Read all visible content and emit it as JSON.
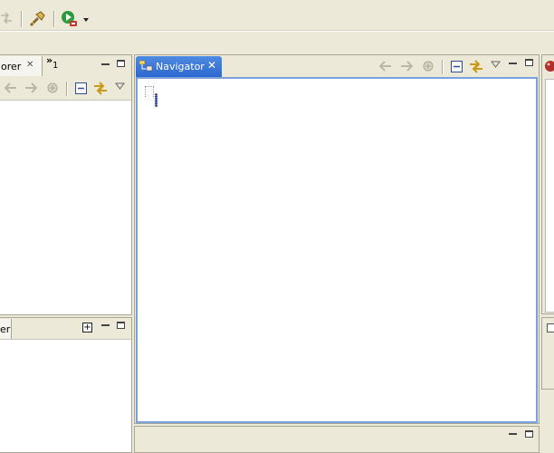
{
  "toolbar": {
    "icons": [
      "nav-arrows-icon",
      "hammer-icon",
      "run-icon",
      "dropdown-arrow-icon"
    ]
  },
  "left_top_view": {
    "tab_label": "orer",
    "close_glyph": "✕",
    "overflow_count": "1",
    "overflow_glyph": "»"
  },
  "left_bottom_view": {
    "tab_label": "er",
    "add_glyph": "+"
  },
  "navigator_view": {
    "tab_label": "Navigator",
    "close_glyph": "✕",
    "accent_color": "#3169c6"
  },
  "colors": {
    "chrome": "#ece9d8",
    "border": "#a9a796",
    "active_border": "#6e9ae2",
    "tab_active": "#316ac5"
  }
}
